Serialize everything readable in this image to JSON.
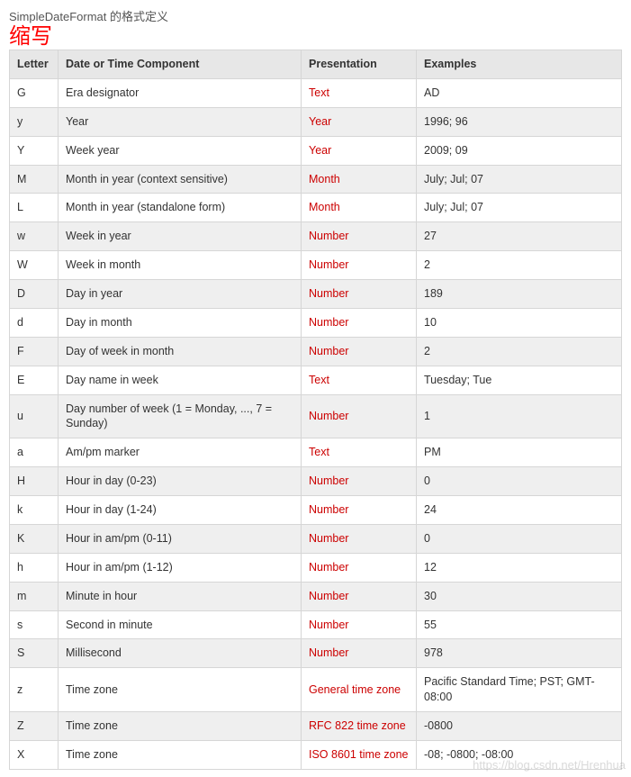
{
  "caption": "SimpleDateFormat 的格式定义",
  "red_label": "缩写",
  "watermark": "https://blog.csdn.net/Hrenhua",
  "headers": {
    "letter": "Letter",
    "component": "Date or Time Component",
    "presentation": "Presentation",
    "examples": "Examples"
  },
  "rows": [
    {
      "letter": "G",
      "component": "Era designator",
      "presentation": "Text",
      "examples": "AD"
    },
    {
      "letter": "y",
      "component": "Year",
      "presentation": "Year",
      "examples": "1996; 96"
    },
    {
      "letter": "Y",
      "component": "Week year",
      "presentation": "Year",
      "examples": "2009; 09"
    },
    {
      "letter": "M",
      "component": "Month in year (context sensitive)",
      "presentation": "Month",
      "examples": "July; Jul; 07"
    },
    {
      "letter": "L",
      "component": "Month in year (standalone form)",
      "presentation": "Month",
      "examples": "July; Jul; 07"
    },
    {
      "letter": "w",
      "component": "Week in year",
      "presentation": "Number",
      "examples": "27"
    },
    {
      "letter": "W",
      "component": "Week in month",
      "presentation": "Number",
      "examples": "2"
    },
    {
      "letter": "D",
      "component": "Day in year",
      "presentation": "Number",
      "examples": "189"
    },
    {
      "letter": "d",
      "component": "Day in month",
      "presentation": "Number",
      "examples": "10"
    },
    {
      "letter": "F",
      "component": "Day of week in month",
      "presentation": "Number",
      "examples": "2"
    },
    {
      "letter": "E",
      "component": "Day name in week",
      "presentation": "Text",
      "examples": "Tuesday; Tue"
    },
    {
      "letter": "u",
      "component": "Day number of week (1 = Monday, ..., 7 = Sunday)",
      "presentation": "Number",
      "examples": "1"
    },
    {
      "letter": "a",
      "component": "Am/pm marker",
      "presentation": "Text",
      "examples": "PM"
    },
    {
      "letter": "H",
      "component": "Hour in day (0-23)",
      "presentation": "Number",
      "examples": "0"
    },
    {
      "letter": "k",
      "component": "Hour in day (1-24)",
      "presentation": "Number",
      "examples": "24"
    },
    {
      "letter": "K",
      "component": "Hour in am/pm (0-11)",
      "presentation": "Number",
      "examples": "0"
    },
    {
      "letter": "h",
      "component": "Hour in am/pm (1-12)",
      "presentation": "Number",
      "examples": "12"
    },
    {
      "letter": "m",
      "component": "Minute in hour",
      "presentation": "Number",
      "examples": "30"
    },
    {
      "letter": "s",
      "component": "Second in minute",
      "presentation": "Number",
      "examples": "55"
    },
    {
      "letter": "S",
      "component": "Millisecond",
      "presentation": "Number",
      "examples": "978"
    },
    {
      "letter": "z",
      "component": "Time zone",
      "presentation": "General time zone",
      "examples": "Pacific Standard Time; PST; GMT-08:00"
    },
    {
      "letter": "Z",
      "component": "Time zone",
      "presentation": "RFC 822 time zone",
      "examples": "-0800"
    },
    {
      "letter": "X",
      "component": "Time zone",
      "presentation": "ISO 8601 time zone",
      "examples": "-08; -0800; -08:00"
    }
  ]
}
